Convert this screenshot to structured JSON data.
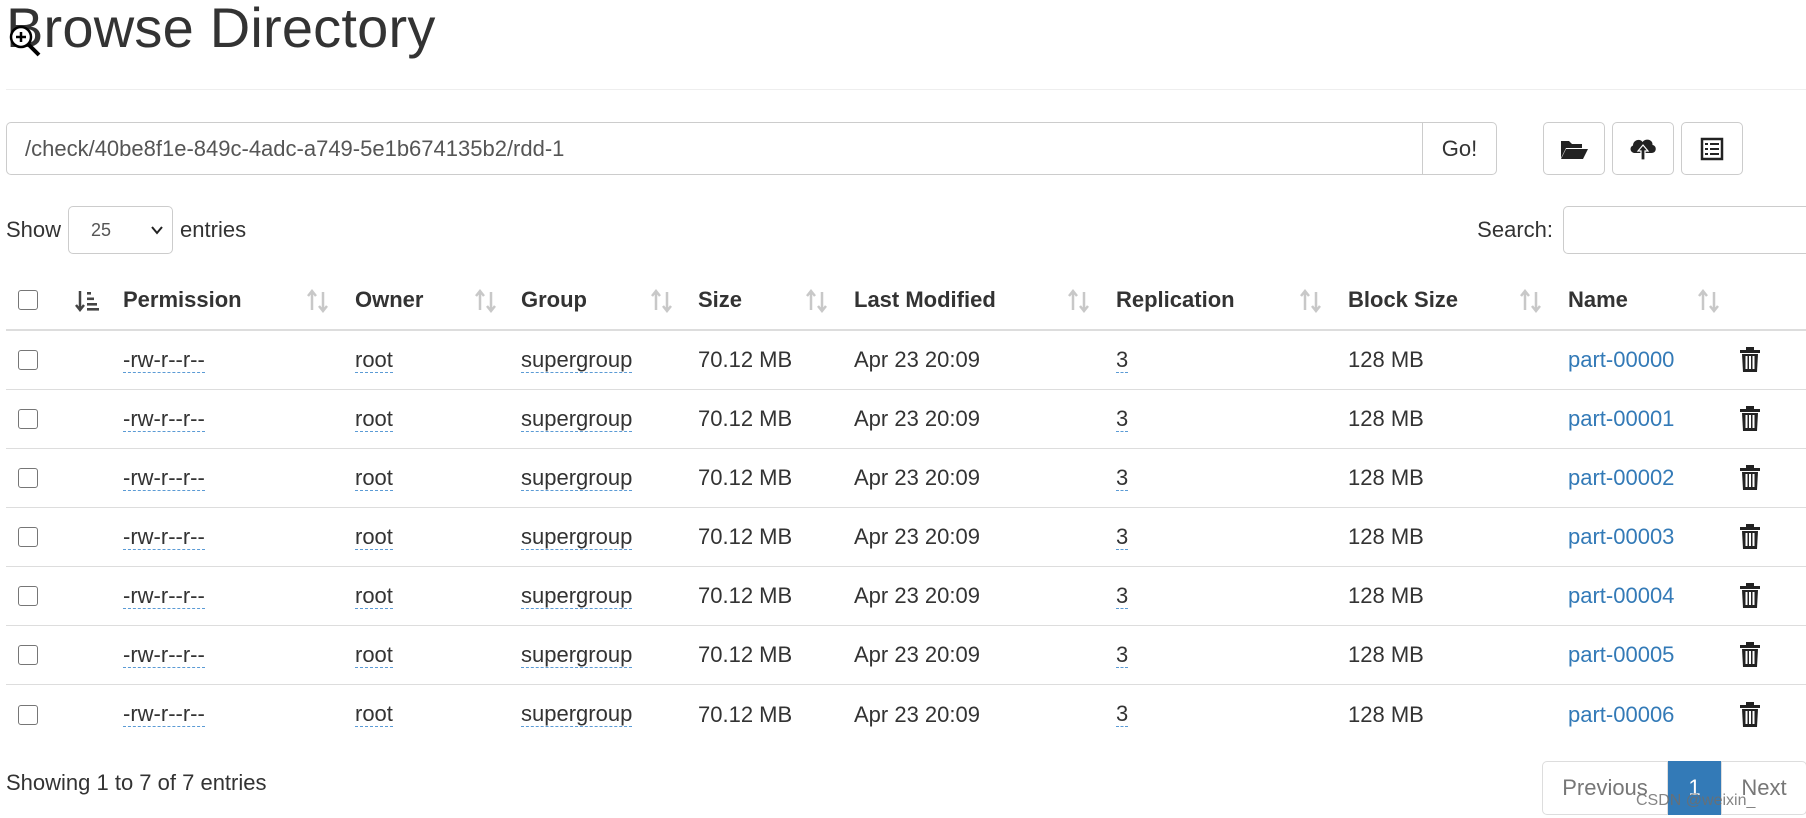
{
  "header": {
    "title": "Browse Directory"
  },
  "path_bar": {
    "path": "/check/40be8f1e-849c-4adc-a749-5e1b674135b2/rdd-1",
    "go_label": "Go!"
  },
  "toolbar": {
    "icons": [
      "folder-open-icon",
      "cloud-upload-icon",
      "list-icon"
    ]
  },
  "length": {
    "show_label": "Show",
    "selected": "25",
    "entries_label": "entries"
  },
  "search": {
    "label": "Search:",
    "value": ""
  },
  "table": {
    "headers": [
      "Permission",
      "Owner",
      "Group",
      "Size",
      "Last Modified",
      "Replication",
      "Block Size",
      "Name"
    ],
    "rows": [
      {
        "permission": "-rw-r--r--",
        "owner": "root",
        "group": "supergroup",
        "size": "70.12 MB",
        "modified": "Apr 23 20:09",
        "replication": "3",
        "block_size": "128 MB",
        "name": "part-00000"
      },
      {
        "permission": "-rw-r--r--",
        "owner": "root",
        "group": "supergroup",
        "size": "70.12 MB",
        "modified": "Apr 23 20:09",
        "replication": "3",
        "block_size": "128 MB",
        "name": "part-00001"
      },
      {
        "permission": "-rw-r--r--",
        "owner": "root",
        "group": "supergroup",
        "size": "70.12 MB",
        "modified": "Apr 23 20:09",
        "replication": "3",
        "block_size": "128 MB",
        "name": "part-00002"
      },
      {
        "permission": "-rw-r--r--",
        "owner": "root",
        "group": "supergroup",
        "size": "70.12 MB",
        "modified": "Apr 23 20:09",
        "replication": "3",
        "block_size": "128 MB",
        "name": "part-00003"
      },
      {
        "permission": "-rw-r--r--",
        "owner": "root",
        "group": "supergroup",
        "size": "70.12 MB",
        "modified": "Apr 23 20:09",
        "replication": "3",
        "block_size": "128 MB",
        "name": "part-00004"
      },
      {
        "permission": "-rw-r--r--",
        "owner": "root",
        "group": "supergroup",
        "size": "70.12 MB",
        "modified": "Apr 23 20:09",
        "replication": "3",
        "block_size": "128 MB",
        "name": "part-00005"
      },
      {
        "permission": "-rw-r--r--",
        "owner": "root",
        "group": "supergroup",
        "size": "70.12 MB",
        "modified": "Apr 23 20:09",
        "replication": "3",
        "block_size": "128 MB",
        "name": "part-00006"
      }
    ]
  },
  "footer": {
    "info": "Showing 1 to 7 of 7 entries",
    "previous": "Previous",
    "current_page": "1",
    "next": "Next"
  },
  "watermark": "CSDN @weixin_"
}
